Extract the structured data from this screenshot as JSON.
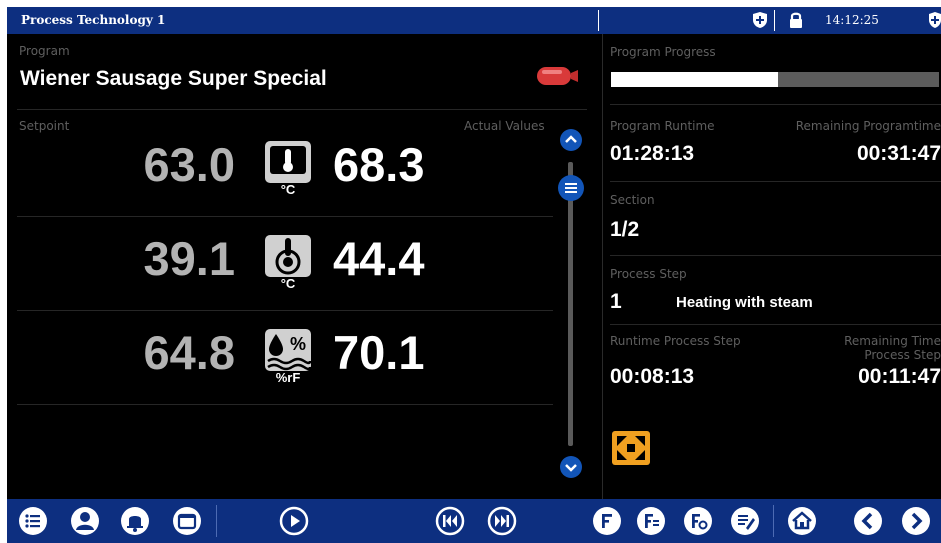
{
  "header": {
    "title": "Process Technology 1",
    "time": "14:12:25"
  },
  "program": {
    "label": "Program",
    "name": "Wiener Sausage Super Special"
  },
  "values": {
    "setpoint_label": "Setpoint",
    "actual_label": "Actual Values",
    "rows": [
      {
        "setpoint": "63.0",
        "actual": "68.3",
        "unit": "°C",
        "icon": "chamber-temperature-icon"
      },
      {
        "setpoint": "39.1",
        "actual": "44.4",
        "unit": "°C",
        "icon": "core-temperature-icon"
      },
      {
        "setpoint": "64.8",
        "actual": "70.1",
        "unit": "%rF",
        "icon": "humidity-icon"
      }
    ]
  },
  "status": {
    "progress_label": "Program Progress",
    "progress_fraction": 0.51,
    "runtime_label": "Program Runtime",
    "runtime": "01:28:13",
    "remaining_label": "Remaining Programtime",
    "remaining": "00:31:47",
    "section_label": "Section",
    "section": "1/2",
    "step_label": "Process Step",
    "step_number": "1",
    "step_name": "Heating with steam",
    "step_runtime_label": "Runtime Process Step",
    "step_runtime": "00:08:13",
    "step_remaining_label_1": "Remaining Time",
    "step_remaining_label_2": "Process Step",
    "step_remaining": "00:11:47"
  },
  "colors": {
    "header_blue": "#0d2f80",
    "button_blue": "#1255b8",
    "accent_orange": "#f0a020",
    "sausage_red": "#d93a3a"
  }
}
